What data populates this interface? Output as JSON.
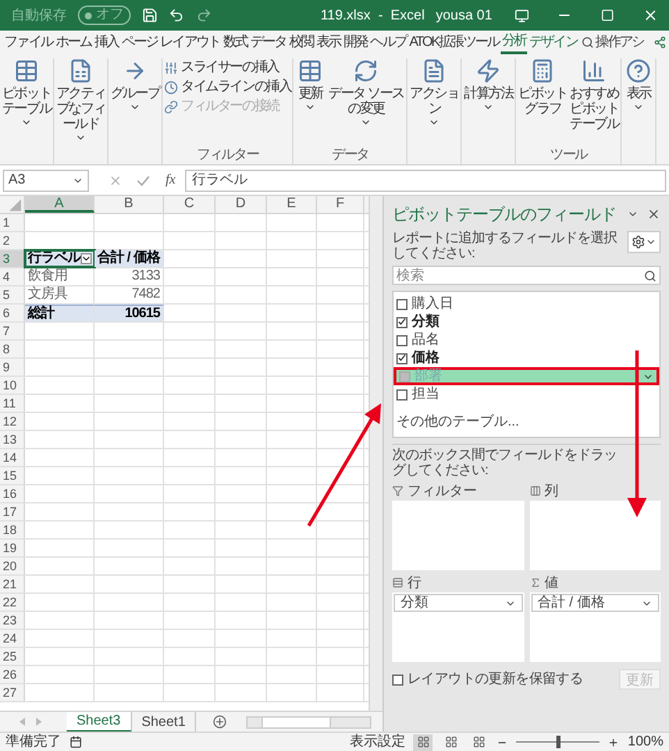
{
  "title_bar": {
    "autosave": "自動保存",
    "autosave_toggle": {
      "label": "オフ",
      "on": false
    },
    "title": "119.xlsx  -  Excel",
    "user": "yousa 01"
  },
  "ribbon_tabs": [
    {
      "label": "ファイル",
      "selected": false,
      "contextual": false
    },
    {
      "label": "ホーム",
      "selected": false,
      "contextual": false
    },
    {
      "label": "挿入",
      "selected": false,
      "contextual": false
    },
    {
      "label": "ページ レイアウト",
      "selected": false,
      "contextual": false
    },
    {
      "label": "数式",
      "selected": false,
      "contextual": false
    },
    {
      "label": "データ",
      "selected": false,
      "contextual": false
    },
    {
      "label": "校閲",
      "selected": false,
      "contextual": false
    },
    {
      "label": "表示",
      "selected": false,
      "contextual": false
    },
    {
      "label": "開発",
      "selected": false,
      "contextual": false
    },
    {
      "label": "ヘルプ",
      "selected": false,
      "contextual": false
    },
    {
      "label": "ATOK拡張ツール",
      "selected": false,
      "contextual": false
    },
    {
      "label": "分析",
      "selected": true,
      "contextual": true
    },
    {
      "label": "デザイン",
      "selected": false,
      "contextual": true
    }
  ],
  "tell_me": "操作アシ",
  "ribbon_groups": [
    {
      "buttons": [
        {
          "kind": "large",
          "label": "ピボットテーブル",
          "dropdown": true,
          "disabled": false
        }
      ]
    },
    {
      "buttons": [
        {
          "kind": "large",
          "label": "アクティブなフィールド",
          "dropdown": true,
          "disabled": false
        }
      ]
    },
    {
      "buttons": [
        {
          "kind": "large",
          "label": "グループ",
          "dropdown": true,
          "disabled": false
        }
      ]
    },
    {
      "label": "フィルター",
      "buttons": [
        {
          "kind": "small",
          "label": "スライサーの挿入",
          "disabled": false
        },
        {
          "kind": "small",
          "label": "タイムラインの挿入",
          "disabled": false
        },
        {
          "kind": "small",
          "label": "フィルターの接続",
          "disabled": true
        }
      ]
    },
    {
      "label": "データ",
      "buttons": [
        {
          "kind": "large",
          "label": "更新",
          "dropdown": true,
          "disabled": false
        },
        {
          "kind": "large",
          "label": "データ ソースの変更",
          "dropdown": true,
          "disabled": false
        }
      ]
    },
    {
      "buttons": [
        {
          "kind": "large",
          "label": "アクション",
          "dropdown": true,
          "disabled": false
        }
      ]
    },
    {
      "buttons": [
        {
          "kind": "large",
          "label": "計算方法",
          "dropdown": true,
          "disabled": false
        }
      ]
    },
    {
      "label": "ツール",
      "buttons": [
        {
          "kind": "large",
          "label": "ピボットグラフ",
          "dropdown": false,
          "disabled": false
        },
        {
          "kind": "large",
          "label": "おすすめピボットテーブル",
          "dropdown": false,
          "disabled": false
        }
      ]
    },
    {
      "buttons": [
        {
          "kind": "large",
          "label": "表示",
          "dropdown": true,
          "disabled": false
        }
      ]
    }
  ],
  "formula_bar": {
    "name_box": "A3",
    "function_label": "fx",
    "formula": "行ラベル"
  },
  "sheet": {
    "columns": [
      {
        "label": "A",
        "selected": true
      },
      {
        "label": "B",
        "selected": false
      },
      {
        "label": "C",
        "selected": false
      },
      {
        "label": "D",
        "selected": false
      },
      {
        "label": "E",
        "selected": false
      },
      {
        "label": "F",
        "selected": false
      }
    ],
    "rows": [
      {
        "number": "1",
        "selected": false
      },
      {
        "number": "2",
        "selected": false
      },
      {
        "number": "3",
        "selected": true,
        "cells": [
          {
            "text": "行ラベル",
            "kind": "header",
            "selected": true,
            "filter_button": true
          },
          {
            "text": "合計 / 価格",
            "kind": "header",
            "selected": false,
            "filter_button": false
          }
        ]
      },
      {
        "number": "4",
        "selected": false,
        "cells": [
          {
            "text": "飲食用",
            "kind": "item",
            "selected": false,
            "filter_button": false
          },
          {
            "text": "3133",
            "kind": "item",
            "selected": false,
            "filter_button": false
          }
        ]
      },
      {
        "number": "5",
        "selected": false,
        "cells": [
          {
            "text": "文房具",
            "kind": "item",
            "selected": false,
            "filter_button": false
          },
          {
            "text": "7482",
            "kind": "item",
            "selected": false,
            "filter_button": false
          }
        ]
      },
      {
        "number": "6",
        "selected": false,
        "cells": [
          {
            "text": "総計",
            "kind": "total",
            "selected": false,
            "filter_button": false
          },
          {
            "text": "10615",
            "kind": "total",
            "selected": false,
            "filter_button": false
          }
        ]
      },
      {
        "number": "7",
        "selected": false
      },
      {
        "number": "8",
        "selected": false
      },
      {
        "number": "9",
        "selected": false
      },
      {
        "number": "10",
        "selected": false
      },
      {
        "number": "11",
        "selected": false
      },
      {
        "number": "12",
        "selected": false
      },
      {
        "number": "13",
        "selected": false
      },
      {
        "number": "14",
        "selected": false
      },
      {
        "number": "15",
        "selected": false
      },
      {
        "number": "16",
        "selected": false
      },
      {
        "number": "17",
        "selected": false
      },
      {
        "number": "18",
        "selected": false
      },
      {
        "number": "19",
        "selected": false
      },
      {
        "number": "20",
        "selected": false
      },
      {
        "number": "21",
        "selected": false
      },
      {
        "number": "22",
        "selected": false
      },
      {
        "number": "23",
        "selected": false
      },
      {
        "number": "24",
        "selected": false
      },
      {
        "number": "25",
        "selected": false
      },
      {
        "number": "26",
        "selected": false
      },
      {
        "number": "27",
        "selected": false
      }
    ]
  },
  "sheet_tabs": [
    {
      "label": "Sheet3",
      "selected": true
    },
    {
      "label": "Sheet1",
      "selected": false
    }
  ],
  "pivot_pane": {
    "title": "ピボットテーブルのフィールド",
    "instruction": "レポートに追加するフィールドを選択してください:",
    "search_placeholder": "検索",
    "fields": [
      {
        "name": "購入日",
        "checked": false,
        "dragging": false
      },
      {
        "name": "分類",
        "checked": true,
        "dragging": false
      },
      {
        "name": "品名",
        "checked": false,
        "dragging": false
      },
      {
        "name": "価格",
        "checked": true,
        "dragging": false
      },
      {
        "name": "部署",
        "checked": false,
        "dragging": true
      },
      {
        "name": "担当",
        "checked": false,
        "dragging": false
      }
    ],
    "more_tables": "その他のテーブル...",
    "areas_instruction": "次のボックス間でフィールドをドラッグしてください:",
    "areas": [
      {
        "label": "フィルター",
        "kind": "filter"
      },
      {
        "label": "列",
        "kind": "columns"
      },
      {
        "label": "行",
        "kind": "rows",
        "items": [
          "分類"
        ]
      },
      {
        "label": "値",
        "kind": "values",
        "items": [
          "合計 / 価格"
        ]
      }
    ],
    "defer": {
      "label": "レイアウトの更新を保留する",
      "checked": false
    },
    "update_button": {
      "label": "更新",
      "disabled": true
    }
  },
  "status_bar": {
    "status": "準備完了",
    "display_settings": "表示設定",
    "views": [
      {
        "selected": true
      },
      {
        "selected": false
      },
      {
        "selected": false
      }
    ],
    "zoom": {
      "level": 0.5,
      "reading": "100%"
    }
  }
}
